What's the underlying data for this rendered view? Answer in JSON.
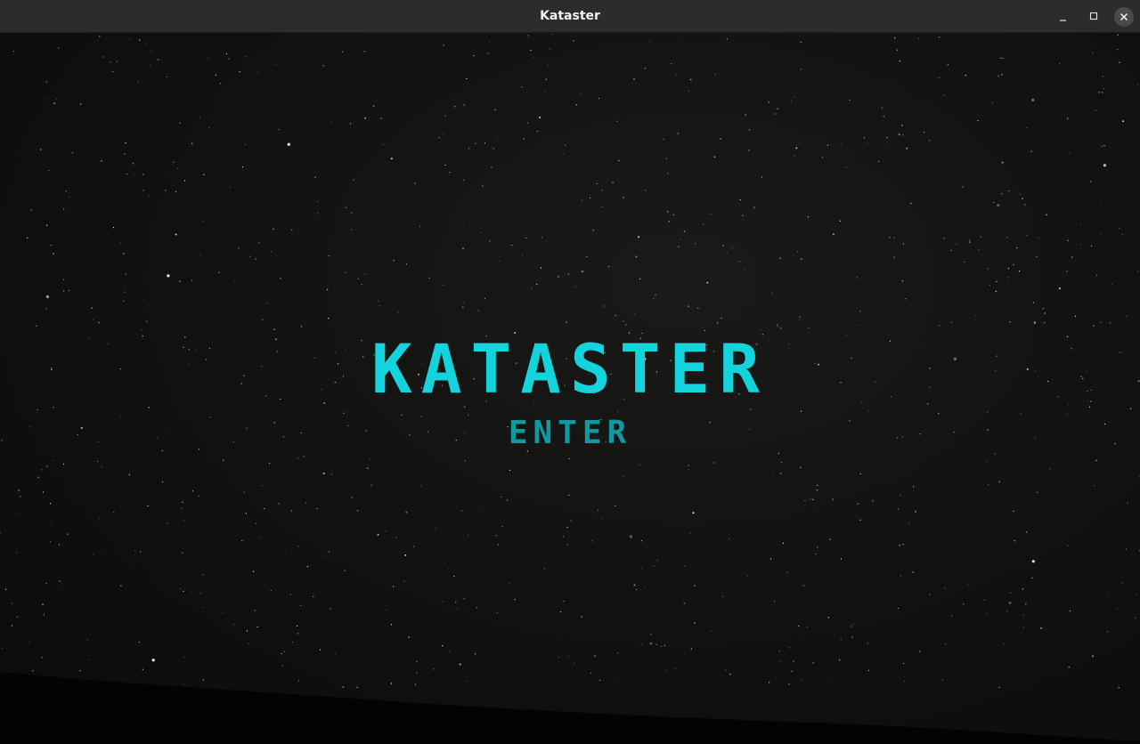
{
  "window": {
    "title": "Kataster"
  },
  "controls": {
    "minimize_icon": "minimize-icon",
    "maximize_icon": "maximize-icon",
    "close_icon": "close-icon"
  },
  "main": {
    "game_title": "KATASTER",
    "enter_label": "ENTER"
  },
  "colors": {
    "accent": "#14d3dc",
    "button_text": "#0f9aa2",
    "titlebar": "#2c2c2c",
    "background": "#0b0b0b"
  }
}
